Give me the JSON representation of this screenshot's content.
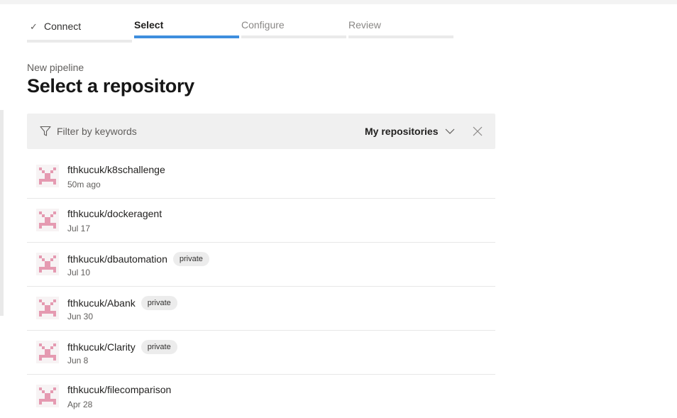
{
  "wizard": {
    "steps": [
      {
        "label": "Connect",
        "state": "done"
      },
      {
        "label": "Select",
        "state": "active"
      },
      {
        "label": "Configure",
        "state": "todo"
      },
      {
        "label": "Review",
        "state": "todo"
      }
    ]
  },
  "header": {
    "subtitle": "New pipeline",
    "title": "Select a repository"
  },
  "filter": {
    "placeholder": "Filter by keywords",
    "scope": "My repositories"
  },
  "colors": {
    "accent": "#3e8ede",
    "avatar": "#e59ab1"
  },
  "repositories": [
    {
      "name": "fthkucuk/k8schallenge",
      "time": "50m ago",
      "badge": ""
    },
    {
      "name": "fthkucuk/dockeragent",
      "time": "Jul 17",
      "badge": ""
    },
    {
      "name": "fthkucuk/dbautomation",
      "time": "Jul 10",
      "badge": "private"
    },
    {
      "name": "fthkucuk/Abank",
      "time": "Jun 30",
      "badge": "private"
    },
    {
      "name": "fthkucuk/Clarity",
      "time": "Jun 8",
      "badge": "private"
    },
    {
      "name": "fthkucuk/filecomparison",
      "time": "Apr 28",
      "badge": ""
    }
  ]
}
